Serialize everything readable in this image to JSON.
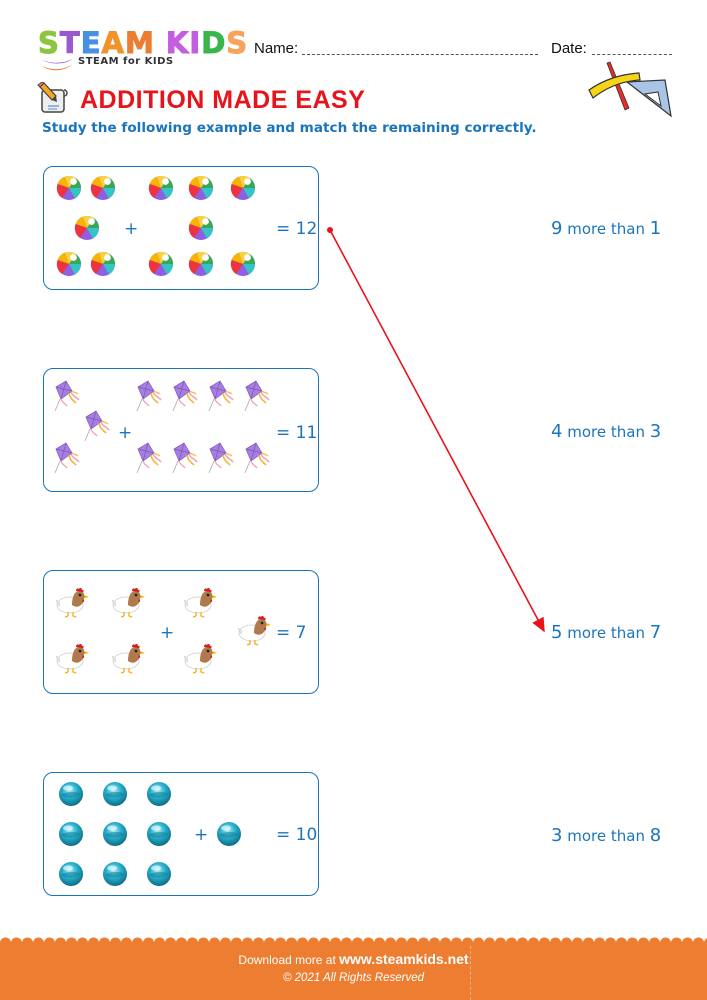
{
  "brand": {
    "logo_letters": [
      {
        "ch": "S",
        "color": "#8cc63f"
      },
      {
        "ch": "T",
        "color": "#9b59d0"
      },
      {
        "ch": "E",
        "color": "#4a90e2"
      },
      {
        "ch": "A",
        "color": "#f0932b"
      },
      {
        "ch": "M",
        "color": "#ed7d31"
      },
      {
        "ch": " ",
        "color": "#ffffff"
      },
      {
        "ch": "K",
        "color": "#c45ee0"
      },
      {
        "ch": "I",
        "color": "#c45ee0"
      },
      {
        "ch": "D",
        "color": "#39b54a"
      },
      {
        "ch": "S",
        "color": "#f7a35c"
      }
    ],
    "tagline": "STEAM for KIDS"
  },
  "header": {
    "name_label": "Name:",
    "date_label": "Date:"
  },
  "worksheet": {
    "title": "ADDITION MADE EASY",
    "instruction": "Study the following example and match the remaining correctly.",
    "accent_color": "#1b75bc",
    "title_color": "#e8141b"
  },
  "problems": [
    {
      "object": "beach-ball",
      "left_count": 5,
      "right_count": 7,
      "result_text": "= 12"
    },
    {
      "object": "kite",
      "left_count": 3,
      "right_count": 8,
      "result_text": "= 11"
    },
    {
      "object": "hen",
      "left_count": 4,
      "right_count": 3,
      "result_text": "= 7"
    },
    {
      "object": "glass-marble",
      "left_count": 9,
      "right_count": 1,
      "result_text": "= 10"
    }
  ],
  "plus_sign": "+",
  "answers": [
    {
      "a": "9",
      "mid": "more than",
      "b": "1"
    },
    {
      "a": "4",
      "mid": "more than",
      "b": "3"
    },
    {
      "a": "5",
      "mid": "more than",
      "b": "7"
    },
    {
      "a": "3",
      "mid": "more than",
      "b": "8"
    }
  ],
  "example_match": {
    "from_problem": 1,
    "to_answer": 3
  },
  "footer": {
    "download_prefix": "Download more at",
    "url": "www.steamkids.net",
    "copyright": "© 2021 All Rights Reserved"
  }
}
